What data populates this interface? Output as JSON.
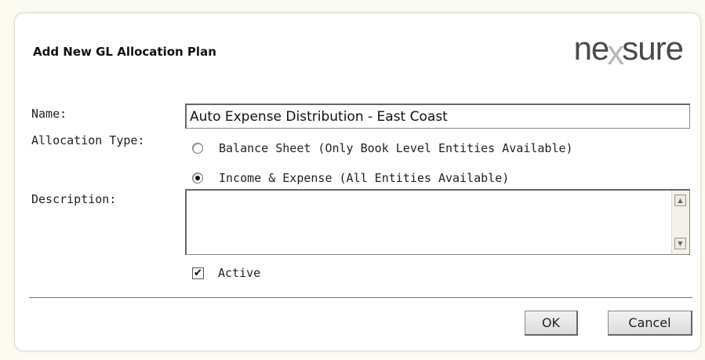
{
  "dialog": {
    "title": "Add New GL Allocation Plan",
    "logo": {
      "part1": "ne",
      "x": "x",
      "part2": "sure"
    }
  },
  "form": {
    "name_label": "Name:",
    "name_value": "Auto Expense Distribution - East Coast",
    "allocation_type_label": "Allocation Type:",
    "allocation_options": [
      {
        "label": "Balance Sheet (Only Book Level Entities Available)",
        "selected": false
      },
      {
        "label": "Income & Expense (All Entities Available)",
        "selected": true
      }
    ],
    "description_label": "Description:",
    "description_value": "",
    "active_label": "Active",
    "active_checked": true,
    "check_glyph": "✔"
  },
  "buttons": {
    "ok": "OK",
    "cancel": "Cancel"
  },
  "icons": {
    "scroll_up": "▲",
    "scroll_down": "▼"
  }
}
